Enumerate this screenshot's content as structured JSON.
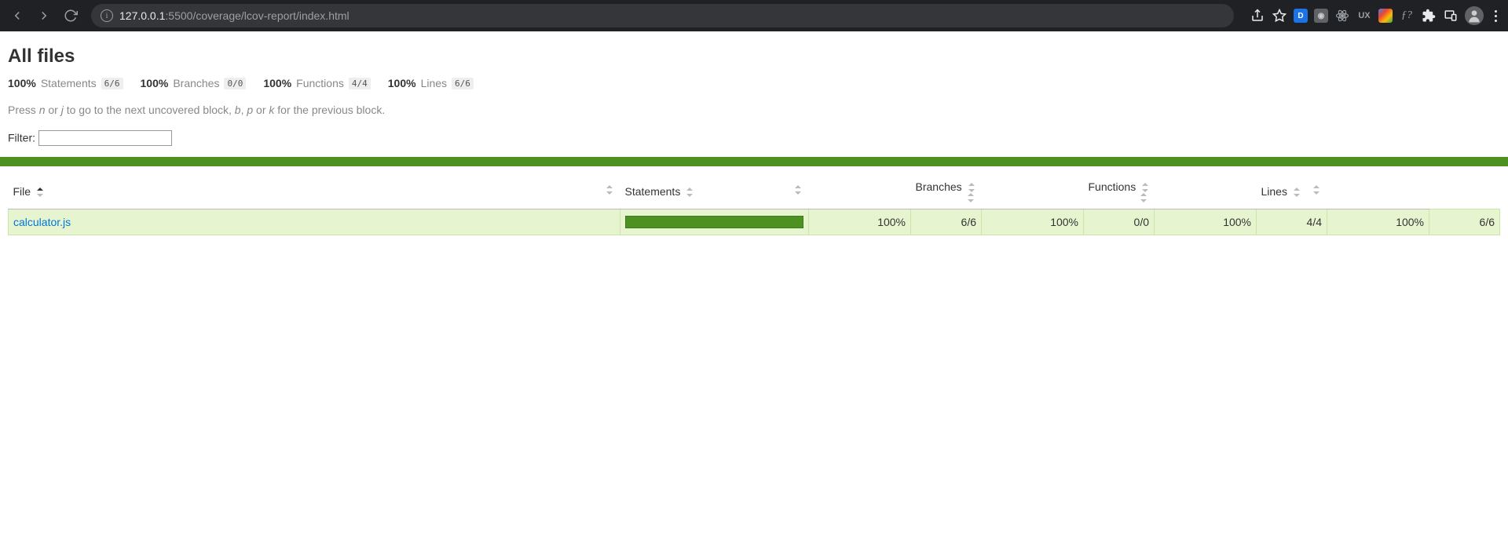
{
  "browser": {
    "url_host": "127.0.0.1",
    "url_port": ":5500",
    "url_path": "/coverage/lcov-report/index.html"
  },
  "page": {
    "title": "All files",
    "summary": [
      {
        "pct": "100%",
        "label": "Statements",
        "frac": "6/6"
      },
      {
        "pct": "100%",
        "label": "Branches",
        "frac": "0/0"
      },
      {
        "pct": "100%",
        "label": "Functions",
        "frac": "4/4"
      },
      {
        "pct": "100%",
        "label": "Lines",
        "frac": "6/6"
      }
    ],
    "hint_pre": "Press ",
    "hint_n": "n",
    "hint_mid1": " or ",
    "hint_j": "j",
    "hint_mid2": " to go to the next uncovered block, ",
    "hint_b": "b",
    "hint_mid3": ", ",
    "hint_p": "p",
    "hint_mid4": " or ",
    "hint_k": "k",
    "hint_end": " for the previous block.",
    "filter_label": "Filter:"
  },
  "table": {
    "headers": {
      "file": "File",
      "statements": "Statements",
      "branches": "Branches",
      "functions": "Functions",
      "lines": "Lines"
    },
    "rows": [
      {
        "file": "calculator.js",
        "bar_pct": 100,
        "statements_pct": "100%",
        "statements_frac": "6/6",
        "branches_pct": "100%",
        "branches_frac": "0/0",
        "functions_pct": "100%",
        "functions_frac": "4/4",
        "lines_pct": "100%",
        "lines_frac": "6/6"
      }
    ]
  }
}
